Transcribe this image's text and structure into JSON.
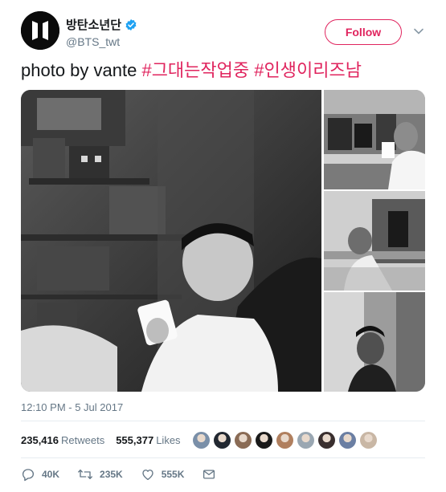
{
  "user": {
    "display_name": "방탄소년단",
    "handle": "@BTS_twt",
    "avatar_icon": "bts-logo-icon",
    "verified_icon": "verified-badge-icon"
  },
  "follow_button": {
    "label": "Follow"
  },
  "caret_icon": "chevron-down-icon",
  "tweet": {
    "text": "photo by vante ",
    "hashtags": [
      "#그대는작업중",
      "#인생이리즈남"
    ]
  },
  "media": {
    "count": 4,
    "style": "grayscale photo grid"
  },
  "timestamp": "12:10 PM - 5 Jul 2017",
  "stats": {
    "retweets_count": "235,416",
    "retweets_label": "Retweets",
    "likes_count": "555,377",
    "likes_label": "Likes"
  },
  "likers": {
    "count": 9,
    "colors": [
      "#7a8fa8",
      "#222831",
      "#8a6b55",
      "#1a1a1a",
      "#b07f5e",
      "#9aa7b2",
      "#3a2f2f",
      "#6b7fa3",
      "#c9b7a5"
    ]
  },
  "actions": {
    "reply_count": "40K",
    "retweet_count": "235K",
    "like_count": "555K",
    "icons": [
      "reply-icon",
      "retweet-icon",
      "like-icon",
      "direct-message-icon"
    ]
  },
  "colors": {
    "accent": "#e0245e",
    "text": "#14171a",
    "muted": "#657786",
    "verified": "#1da1f2"
  }
}
